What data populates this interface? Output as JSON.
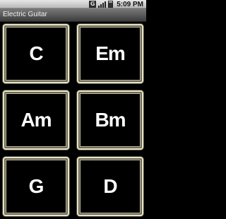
{
  "status_bar": {
    "time": "5:09 PM",
    "icons": [
      "usb-debug-icon",
      "signal-icon",
      "battery-icon"
    ],
    "usb_glyph": "G"
  },
  "app": {
    "title": "Electric Guitar"
  },
  "chords": [
    {
      "label": "C"
    },
    {
      "label": "Em"
    },
    {
      "label": "Am"
    },
    {
      "label": "Bm"
    },
    {
      "label": "G"
    },
    {
      "label": "D"
    }
  ]
}
